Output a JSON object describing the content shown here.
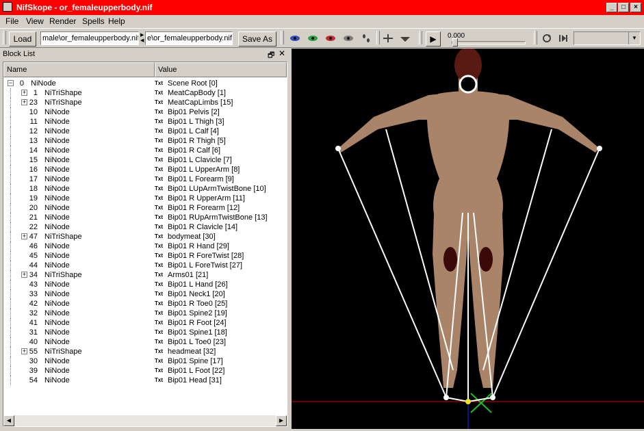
{
  "window": {
    "title": "NifSkope - or_femaleupperbody.nif"
  },
  "menu": [
    "File",
    "View",
    "Render",
    "Spells",
    "Help"
  ],
  "toolbar": {
    "load_label": "Load",
    "load_path": "male\\or_femaleupperbody.nif",
    "save_path": "e\\or_femaleupperbody.nif",
    "save_label": "Save As",
    "time_value": "0.000"
  },
  "blocklist": {
    "title": "Block List",
    "col_name": "Name",
    "col_value": "Value",
    "txt_tag": "Txt",
    "rows": [
      {
        "num": "0",
        "type": "NiNode",
        "value": "Scene Root [0]",
        "level": 0,
        "exp": "-"
      },
      {
        "num": "1",
        "type": "NiTriShape",
        "value": "MeatCapBody [1]",
        "level": 1,
        "exp": "+"
      },
      {
        "num": "23",
        "type": "NiTriShape",
        "value": "MeatCapLimbs [15]",
        "level": 1,
        "exp": "+"
      },
      {
        "num": "10",
        "type": "NiNode",
        "value": "Bip01 Pelvis [2]",
        "level": 1,
        "exp": ""
      },
      {
        "num": "11",
        "type": "NiNode",
        "value": "Bip01 L Thigh [3]",
        "level": 1,
        "exp": ""
      },
      {
        "num": "12",
        "type": "NiNode",
        "value": "Bip01 L Calf [4]",
        "level": 1,
        "exp": ""
      },
      {
        "num": "13",
        "type": "NiNode",
        "value": "Bip01 R Thigh [5]",
        "level": 1,
        "exp": ""
      },
      {
        "num": "14",
        "type": "NiNode",
        "value": "Bip01 R Calf [6]",
        "level": 1,
        "exp": ""
      },
      {
        "num": "15",
        "type": "NiNode",
        "value": "Bip01 L Clavicle [7]",
        "level": 1,
        "exp": ""
      },
      {
        "num": "16",
        "type": "NiNode",
        "value": "Bip01 L UpperArm [8]",
        "level": 1,
        "exp": ""
      },
      {
        "num": "17",
        "type": "NiNode",
        "value": "Bip01 L Forearm [9]",
        "level": 1,
        "exp": ""
      },
      {
        "num": "18",
        "type": "NiNode",
        "value": "Bip01 LUpArmTwistBone [10]",
        "level": 1,
        "exp": ""
      },
      {
        "num": "19",
        "type": "NiNode",
        "value": "Bip01 R UpperArm [11]",
        "level": 1,
        "exp": ""
      },
      {
        "num": "20",
        "type": "NiNode",
        "value": "Bip01 R Forearm [12]",
        "level": 1,
        "exp": ""
      },
      {
        "num": "21",
        "type": "NiNode",
        "value": "Bip01 RUpArmTwistBone [13]",
        "level": 1,
        "exp": ""
      },
      {
        "num": "22",
        "type": "NiNode",
        "value": "Bip01 R Clavicle [14]",
        "level": 1,
        "exp": ""
      },
      {
        "num": "47",
        "type": "NiTriShape",
        "value": "bodymeat [30]",
        "level": 1,
        "exp": "+"
      },
      {
        "num": "46",
        "type": "NiNode",
        "value": "Bip01 R Hand [29]",
        "level": 1,
        "exp": ""
      },
      {
        "num": "45",
        "type": "NiNode",
        "value": "Bip01 R ForeTwist [28]",
        "level": 1,
        "exp": ""
      },
      {
        "num": "44",
        "type": "NiNode",
        "value": "Bip01 L ForeTwist [27]",
        "level": 1,
        "exp": ""
      },
      {
        "num": "34",
        "type": "NiTriShape",
        "value": "Arms01 [21]",
        "level": 1,
        "exp": "+"
      },
      {
        "num": "43",
        "type": "NiNode",
        "value": "Bip01 L Hand [26]",
        "level": 1,
        "exp": ""
      },
      {
        "num": "33",
        "type": "NiNode",
        "value": "Bip01 Neck1 [20]",
        "level": 1,
        "exp": ""
      },
      {
        "num": "42",
        "type": "NiNode",
        "value": "Bip01 R Toe0 [25]",
        "level": 1,
        "exp": ""
      },
      {
        "num": "32",
        "type": "NiNode",
        "value": "Bip01 Spine2 [19]",
        "level": 1,
        "exp": ""
      },
      {
        "num": "41",
        "type": "NiNode",
        "value": "Bip01 R Foot [24]",
        "level": 1,
        "exp": ""
      },
      {
        "num": "31",
        "type": "NiNode",
        "value": "Bip01 Spine1 [18]",
        "level": 1,
        "exp": ""
      },
      {
        "num": "40",
        "type": "NiNode",
        "value": "Bip01 L Toe0 [23]",
        "level": 1,
        "exp": ""
      },
      {
        "num": "55",
        "type": "NiTriShape",
        "value": "headmeat [32]",
        "level": 1,
        "exp": "+"
      },
      {
        "num": "30",
        "type": "NiNode",
        "value": "Bip01 Spine [17]",
        "level": 1,
        "exp": ""
      },
      {
        "num": "39",
        "type": "NiNode",
        "value": "Bip01 L Foot [22]",
        "level": 1,
        "exp": ""
      },
      {
        "num": "54",
        "type": "NiNode",
        "value": "Bip01 Head [31]",
        "level": 1,
        "exp": ""
      }
    ]
  },
  "colors": {
    "titlebar": "#ff0000",
    "viewport_bg": "#000000",
    "skin": "#a98468"
  }
}
